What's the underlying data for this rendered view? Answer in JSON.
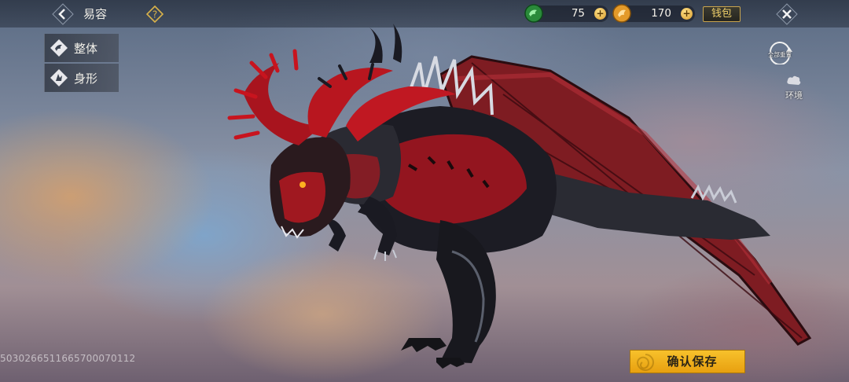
{
  "header": {
    "title": "易容",
    "back_icon": "chevron-left-icon",
    "help_icon": "question-diamond-icon",
    "close_icon": "close-x-icon"
  },
  "currencies": [
    {
      "name": "dragon-coin",
      "amount": "75",
      "icon": "green-dragon-coin-icon"
    },
    {
      "name": "gold-coin",
      "amount": "170",
      "icon": "gold-coin-icon"
    }
  ],
  "wallet": {
    "label": "钱包"
  },
  "tabs": [
    {
      "label": "整体",
      "icon": "whole-body-icon"
    },
    {
      "label": "身形",
      "icon": "body-shape-icon"
    }
  ],
  "tools": {
    "reset_all": {
      "label": "全部重置",
      "icon": "reset-cycle-icon"
    },
    "environment": {
      "label": "环境",
      "icon": "environment-cloud-icon"
    }
  },
  "footer": {
    "uid": "5030266511665700070112",
    "confirm_label": "确认保存"
  },
  "colors": {
    "accent_gold": "#f0b41e",
    "wallet_border": "#c9a54e",
    "dragon_red": "#c8141e",
    "dragon_black": "#1a1a22"
  }
}
